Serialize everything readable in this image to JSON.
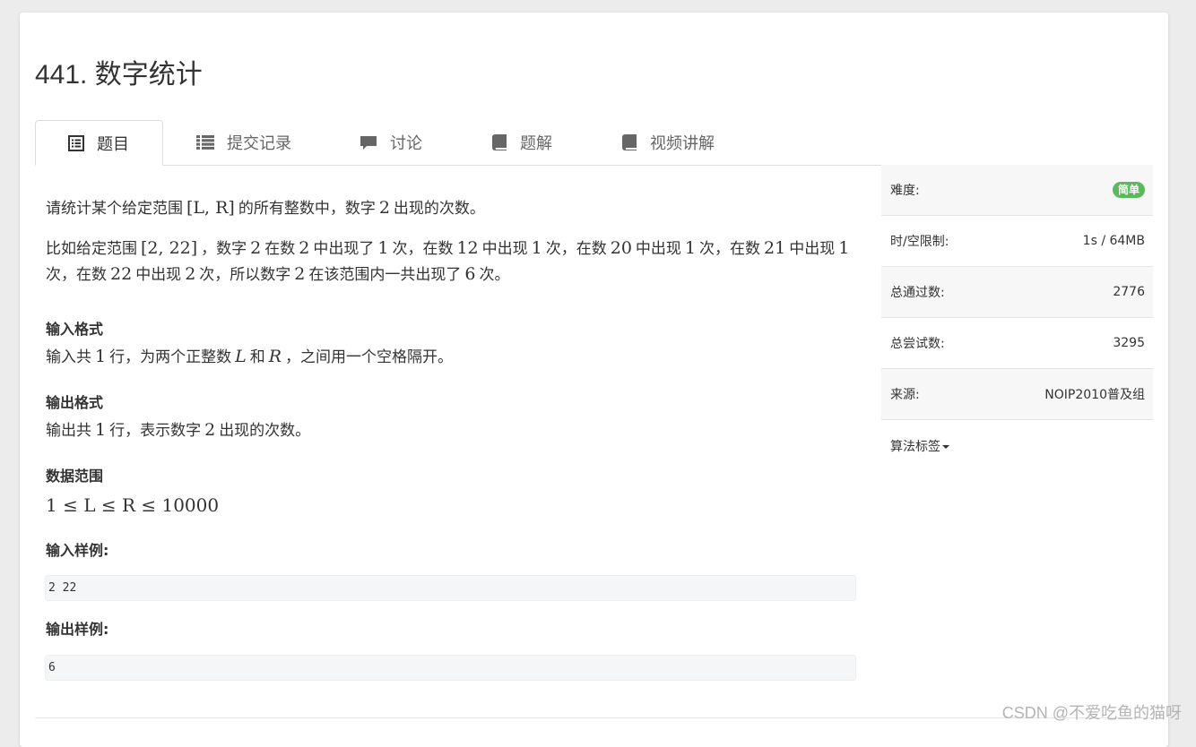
{
  "problem": {
    "title": "441. 数字统计"
  },
  "tabs": [
    {
      "label": "题目",
      "icon": "document-list-icon",
      "active": true
    },
    {
      "label": "提交记录",
      "icon": "list-icon",
      "active": false
    },
    {
      "label": "讨论",
      "icon": "comment-icon",
      "active": false
    },
    {
      "label": "题解",
      "icon": "book-icon",
      "active": false
    },
    {
      "label": "视频讲解",
      "icon": "book-icon",
      "active": false
    }
  ],
  "statement": {
    "p1": {
      "a": "请统计某个给定范围",
      "m1": "[L, R]",
      "b": "的所有整数中，数字",
      "m2": "2",
      "c": "出现的次数。"
    },
    "p2": {
      "a": "比如给定范围",
      "m1": "[2, 22]",
      "b": "，数字",
      "m2": "2",
      "c": "在数",
      "m3": "2",
      "d": "中出现了",
      "m4": "1",
      "e": "次，在数",
      "m5": "12",
      "f": "中出现",
      "m6": "1",
      "g": "次，在数",
      "m7": "20",
      "h": "中出现",
      "m8": "1",
      "i": "次，在数",
      "m9": "21",
      "j": "中出现",
      "m10": "1",
      "k": "次，在数",
      "m11": "22",
      "l": "中出现",
      "m12": "2",
      "n": "次，所以数字",
      "m13": "2",
      "o": "在该范围内一共出现了",
      "m14": "6",
      "p": "次。"
    },
    "input_format_heading": "输入格式",
    "input_format": {
      "a": "输入共",
      "m1": "1",
      "b": "行，为两个正整数",
      "m2": "L",
      "c": "和",
      "m3": "R",
      "d": "，之间用一个空格隔开。"
    },
    "output_format_heading": "输出格式",
    "output_format": {
      "a": "输出共",
      "m1": "1",
      "b": "行，表示数字",
      "m2": "2",
      "c": "出现的次数。"
    },
    "range_heading": "数据范围",
    "range": "1 ≤ L ≤ R ≤ 10000",
    "sample_input_heading": "输入样例:",
    "sample_input": "2 22",
    "sample_output_heading": "输出样例:",
    "sample_output": "6"
  },
  "sidebar": {
    "difficulty_label": "难度:",
    "difficulty_value": "简单",
    "limits_label": "时/空限制:",
    "limits_value": "1s / 64MB",
    "passed_label": "总通过数:",
    "passed_value": "2776",
    "attempts_label": "总尝试数:",
    "attempts_value": "3295",
    "source_label": "来源:",
    "source_value": "NOIP2010普及组",
    "tags_label": "算法标签"
  },
  "watermark": "CSDN @不爱吃鱼的猫呀",
  "colors": {
    "badge": "#5cb85c",
    "border": "#dddddd",
    "shade": "#f7f7f7"
  }
}
